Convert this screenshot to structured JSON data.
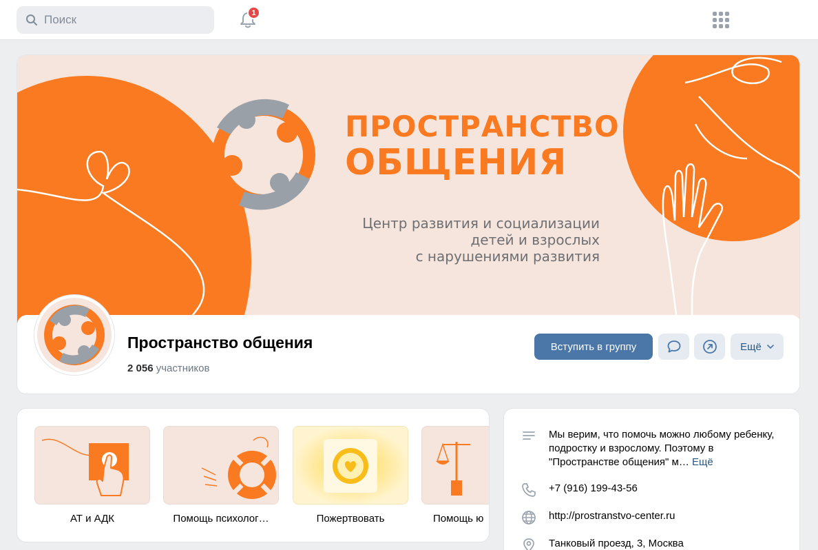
{
  "topbar": {
    "search_placeholder": "Поиск",
    "notifications_count": "1"
  },
  "cover": {
    "title_line1": "ПРОСТРАНСТВО",
    "title_line2": "ОБЩЕНИЯ",
    "subtitle_line1": "Центр развития и социализации",
    "subtitle_line2": "детей и взрослых",
    "subtitle_line3": "с нарушениями развития"
  },
  "group": {
    "name": "Пространство общения",
    "members_count": "2 056",
    "members_label": "участников",
    "join_label": "Вступить в группу",
    "more_label": "Ещё"
  },
  "tiles": [
    {
      "label": "АТ и АДК",
      "icon": "hand-card-icon"
    },
    {
      "label": "Помощь психолог…",
      "icon": "lifebuoy-icon"
    },
    {
      "label": "Пожертвовать",
      "icon": "heart-coin-icon"
    },
    {
      "label": "Помощь ю",
      "icon": "scales-icon"
    }
  ],
  "about": {
    "description": "Мы верим, что помочь можно любому ребенку, подростку и взрослому. Поэтому в \"Пространстве общения\" м…",
    "more": "Ещё",
    "phone": "+7 (916) 199-43-56",
    "website": "http://prostranstvo-center.ru",
    "address": "Танковый проезд, 3, Москва"
  },
  "colors": {
    "accent_orange": "#f97a20",
    "logo_grey": "#9aa0a8",
    "button_blue": "#4a76a8",
    "cover_bg": "#f6e5dd"
  }
}
